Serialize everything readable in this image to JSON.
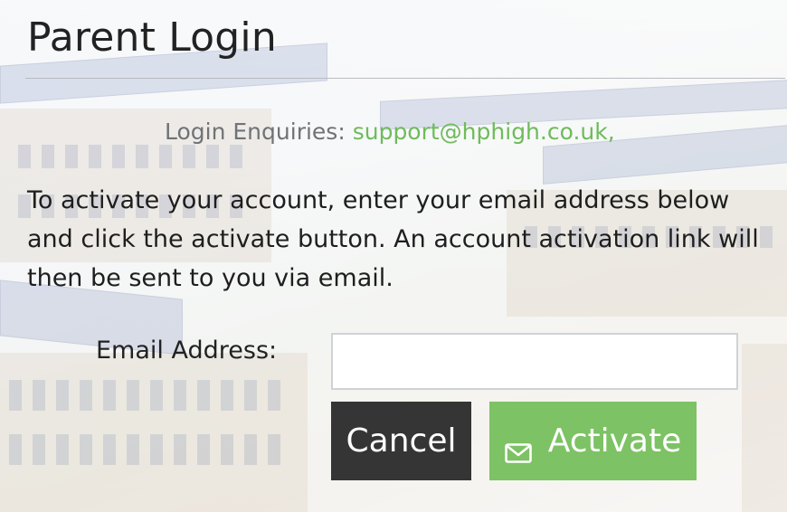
{
  "page": {
    "title": "Parent Login"
  },
  "enquiries": {
    "label": "Login Enquiries:",
    "email": "support@hphigh.co.uk,"
  },
  "instructions": "To activate your account, enter your email address below and click the activate button. An account activation link will then be sent to you via email.",
  "form": {
    "email_label": "Email Address:",
    "email_value": "",
    "email_placeholder": ""
  },
  "buttons": {
    "cancel_label": "Cancel",
    "activate_label": "Activate",
    "activate_icon": "envelope-icon"
  },
  "colors": {
    "accent_green": "#7dc264",
    "link_green": "#6fbb5b",
    "cancel_dark": "#353535"
  }
}
